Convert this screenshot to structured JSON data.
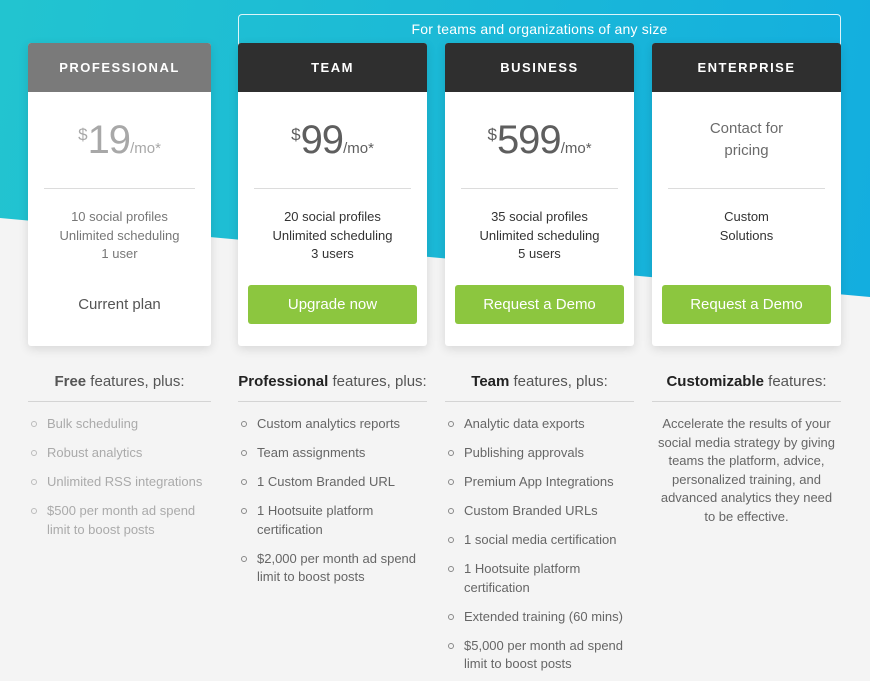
{
  "banner": {
    "text": "For teams and organizations of any size"
  },
  "plans": [
    {
      "name": "PROFESSIONAL",
      "price": {
        "currency": "$",
        "amount": "19",
        "period": "/mo*"
      },
      "summary": [
        "10 social profiles",
        "Unlimited scheduling",
        "1 user"
      ],
      "action": {
        "label": "Current plan",
        "type": "status"
      }
    },
    {
      "name": "TEAM",
      "price": {
        "currency": "$",
        "amount": "99",
        "period": "/mo*"
      },
      "summary": [
        "20 social profiles",
        "Unlimited scheduling",
        "3 users"
      ],
      "action": {
        "label": "Upgrade now",
        "type": "button"
      }
    },
    {
      "name": "BUSINESS",
      "price": {
        "currency": "$",
        "amount": "599",
        "period": "/mo*"
      },
      "summary": [
        "35 social profiles",
        "Unlimited scheduling",
        "5 users"
      ],
      "action": {
        "label": "Request a Demo",
        "type": "button"
      }
    },
    {
      "name": "ENTERPRISE",
      "contact": "Contact for\npricing",
      "summary": [
        "Custom",
        "Solutions"
      ],
      "action": {
        "label": "Request a Demo",
        "type": "button"
      }
    }
  ],
  "features": [
    {
      "title_bold": "Free",
      "title_rest": " features, plus:",
      "items": [
        "Bulk scheduling",
        "Robust analytics",
        "Unlimited RSS integrations",
        "$500 per month ad spend limit to boost posts"
      ]
    },
    {
      "title_bold": "Professional",
      "title_rest": " features, plus:",
      "items": [
        "Custom analytics reports",
        "Team assignments",
        "1 Custom Branded URL",
        "1 Hootsuite platform certification",
        "$2,000 per month ad spend limit to boost posts"
      ]
    },
    {
      "title_bold": "Team",
      "title_rest": " features, plus:",
      "items": [
        "Analytic data exports",
        "Publishing approvals",
        "Premium App Integrations",
        "Custom Branded URLs",
        "1 social media certification",
        "1 Hootsuite platform certification",
        "Extended training (60 mins)",
        "$5,000 per month ad spend limit to boost posts"
      ]
    },
    {
      "title_bold": "Customizable",
      "title_rest": " features:",
      "description": "Accelerate the results of your social media strategy by giving teams the platform, advice, personalized training, and advanced analytics they need to be effective."
    }
  ],
  "colors": {
    "accent_green": "#8cc63f",
    "header_dark": "#2f2f2f",
    "header_current": "#7a7a7a",
    "hero_teal": "#22c4d0",
    "hero_blue": "#13aedf"
  }
}
